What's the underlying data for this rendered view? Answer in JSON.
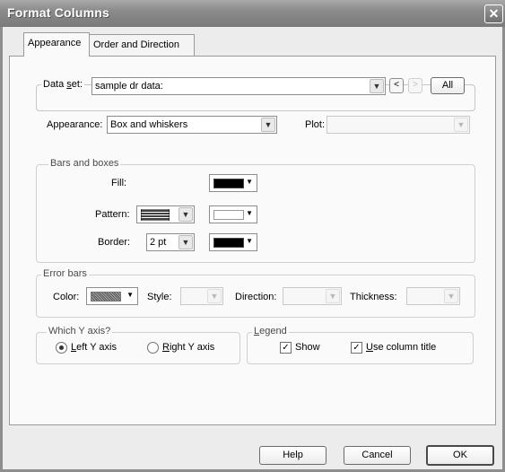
{
  "window": {
    "title": "Format Columns",
    "close_glyph": "✕"
  },
  "tabs": [
    {
      "label": "Appearance",
      "active": true
    },
    {
      "label": "Order and Direction",
      "active": false
    }
  ],
  "dataset": {
    "label_pre": "Data ",
    "label_mnemonic": "s",
    "label_post": "et:",
    "value": "sample dr data:",
    "prev": "<",
    "next": ">",
    "all_label": "All"
  },
  "appearance": {
    "label": "Appearance:",
    "value": "Box and whiskers",
    "plot_label": "Plot:",
    "plot_value": ""
  },
  "bars_boxes": {
    "title": "Bars and boxes",
    "fill_label": "Fill:",
    "fill_color": "#000000",
    "pattern_label": "Pattern:",
    "pattern_color": "#ffffff",
    "border_label": "Border:",
    "border_value": "2 pt",
    "border_color": "#000000"
  },
  "error_bars": {
    "title": "Error bars",
    "color_label": "Color:",
    "style_label": "Style:",
    "style_value": "",
    "direction_label": "Direction:",
    "direction_value": "",
    "thickness_label": "Thickness:",
    "thickness_value": "",
    "color_swatch": "#777777"
  },
  "y_axis": {
    "title": "Which Y axis?",
    "left_mnemonic": "L",
    "left_rest": "eft Y axis",
    "left_selected": true,
    "right_mnemonic": "R",
    "right_rest": "ight  Y axis",
    "right_selected": false
  },
  "legend": {
    "title_mnemonic": "L",
    "title_rest": "egend",
    "show_label": "Show",
    "show_checked": true,
    "use_title_mnemonic": "U",
    "use_title_rest": "se column title",
    "use_title_checked": true
  },
  "buttons": {
    "help": "Help",
    "cancel": "Cancel",
    "ok": "OK"
  },
  "icons": {
    "combo_arrow": "chevron-down-icon",
    "check": "✓"
  }
}
